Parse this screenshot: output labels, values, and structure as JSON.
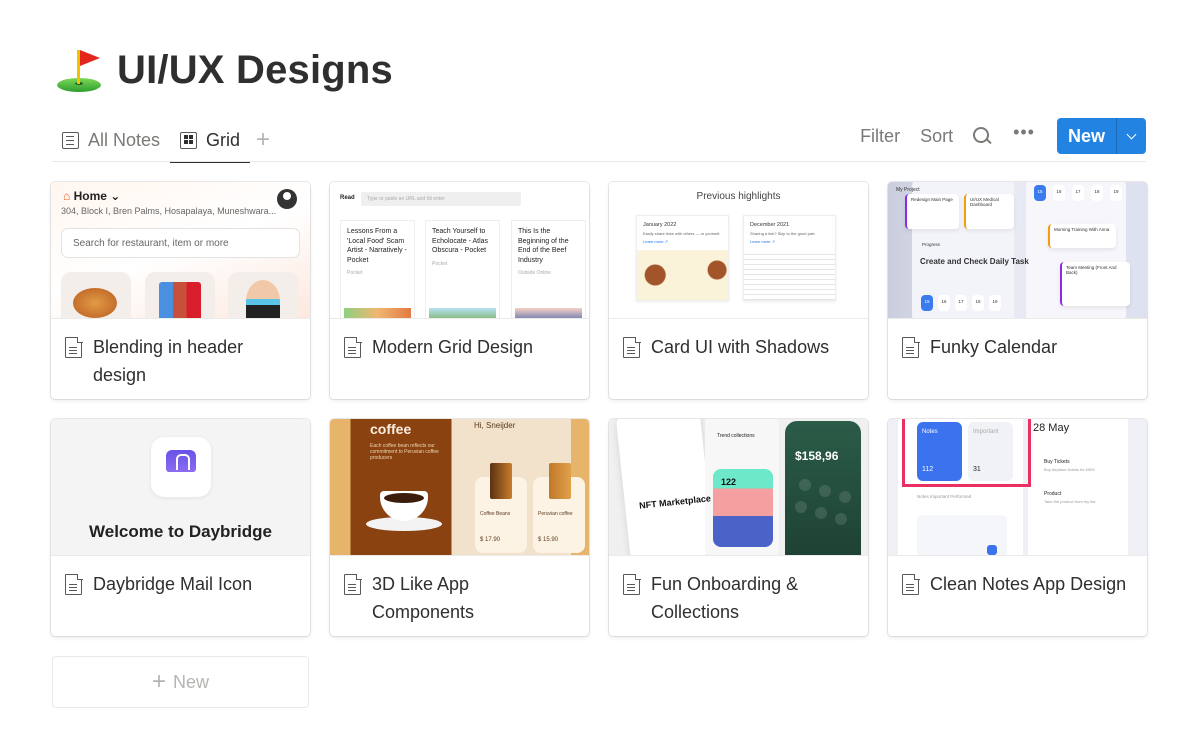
{
  "page": {
    "emoji": "flag-in-hole",
    "title": "UI/UX Designs"
  },
  "views": {
    "tabs": [
      {
        "label": "All Notes",
        "icon": "notes-icon",
        "active": false
      },
      {
        "label": "Grid",
        "icon": "grid-icon",
        "active": true
      }
    ],
    "add_view": "+"
  },
  "toolbar": {
    "filter_label": "Filter",
    "sort_label": "Sort",
    "search_icon": "search-icon",
    "more_label": "•••",
    "new_label": "New",
    "accent_color": "#2383e2"
  },
  "cards": [
    {
      "title": "Blending in header design",
      "thumb": {
        "home": "Home",
        "address": "304, Block I, Bren Palms, Hosapalaya, Muneshwara...",
        "search_placeholder": "Search for restaurant, item or more"
      }
    },
    {
      "title": "Modern Grid Design",
      "thumb": {
        "read": "Read",
        "url_placeholder": "Type or paste an URL and hit enter",
        "articles": [
          {
            "title": "Lessons From a 'Local Food' Scam Artist - Narratively - Pocket",
            "source": "Pocket"
          },
          {
            "title": "Teach Yourself to Echolocate - Atlas Obscura - Pocket",
            "source": "Pocket"
          },
          {
            "title": "This Is the Beginning of the End of the Beef Industry",
            "source": "Outside Online"
          }
        ]
      }
    },
    {
      "title": "Card UI with Shadows",
      "thumb": {
        "heading": "Previous highlights",
        "items": [
          {
            "date": "January 2022",
            "text": "Easily share links with others — or yourself.",
            "link": "Learn more ↗"
          },
          {
            "date": "December 2021",
            "text": "Sharing a link? Skip to the good part.",
            "link": "Learn more ↗"
          }
        ]
      }
    },
    {
      "title": "Funky Calendar",
      "thumb": {
        "my_project": "My Project",
        "project_a": "Redesign Main Page",
        "project_b": "UI/UX Medical Dashboard",
        "progress": "Progress",
        "headline": "Create and Check Daily Task",
        "days": [
          "15",
          "16",
          "17",
          "18",
          "19"
        ],
        "event_a": "Morning Training With Anna",
        "event_b": "Team Meeting (Front And Back)"
      }
    },
    {
      "title": "Daybridge Mail Icon",
      "thumb": {
        "welcome": "Welcome to Daybridge"
      }
    },
    {
      "title": "3D Like App Components",
      "thumb": {
        "coffee": "coffee",
        "coffee_desc": "Each coffee bean reflects our commitment to Peruvian coffee producers",
        "greeting": "Hi, Sneijder",
        "product_a": "Coffee Beans",
        "price_a": "$ 17.90",
        "product_b": "Peruvian coffee",
        "price_b": "$ 15.90"
      }
    },
    {
      "title": "Fun Onboarding & Collections",
      "thumb": {
        "nft": "NFT Marketplace",
        "trend": "Trend collections",
        "count": "122",
        "amount": "$158,96"
      }
    },
    {
      "title": "Clean Notes App Design",
      "thumb": {
        "notes_label": "Notes",
        "notes_count": "112",
        "important_label": "Important",
        "important_count": "31",
        "date": "28 May",
        "task_a": "Buy Tickets",
        "task_a_desc": "Buy Airplane tickets for £559",
        "task_b": "Product",
        "task_b_desc": "Take the product from my list.",
        "tabs": "Notes   Important   Performed"
      }
    }
  ],
  "add_new": {
    "label": "New"
  }
}
